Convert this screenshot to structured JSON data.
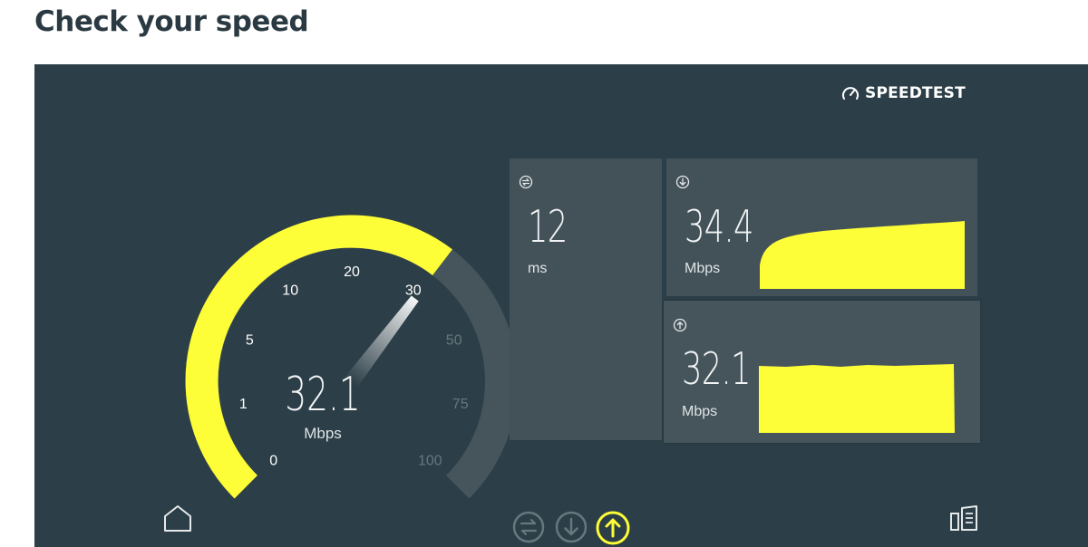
{
  "page": {
    "title": "Check your speed"
  },
  "brand": {
    "name": "SPEEDTEST",
    "icon": "speedometer-icon"
  },
  "gauge": {
    "value": "32.1",
    "value_number": 32.1,
    "unit": "Mbps",
    "ticks": [
      "0",
      "1",
      "5",
      "10",
      "20",
      "30",
      "50",
      "75",
      "100"
    ],
    "active_ticks": 6,
    "fill_color": "#fdfd38",
    "track_color": "#46555c"
  },
  "ping": {
    "value": "12",
    "unit": "ms",
    "icon": "ping-icon"
  },
  "download": {
    "value": "34.4",
    "unit": "Mbps",
    "icon": "download-arrow-icon"
  },
  "upload": {
    "value": "32.1",
    "unit": "Mbps",
    "icon": "upload-arrow-icon"
  },
  "bottom_nav": {
    "home_icon": "home-icon",
    "steps": [
      {
        "icon": "ping-step-icon",
        "active": false
      },
      {
        "icon": "download-step-icon",
        "active": false
      },
      {
        "icon": "upload-step-icon",
        "active": true
      }
    ],
    "results_icon": "results-icon"
  },
  "colors": {
    "background": "#2c3e47",
    "panel": "#435259",
    "accent": "#fdfd38",
    "muted_text": "#66777e"
  }
}
